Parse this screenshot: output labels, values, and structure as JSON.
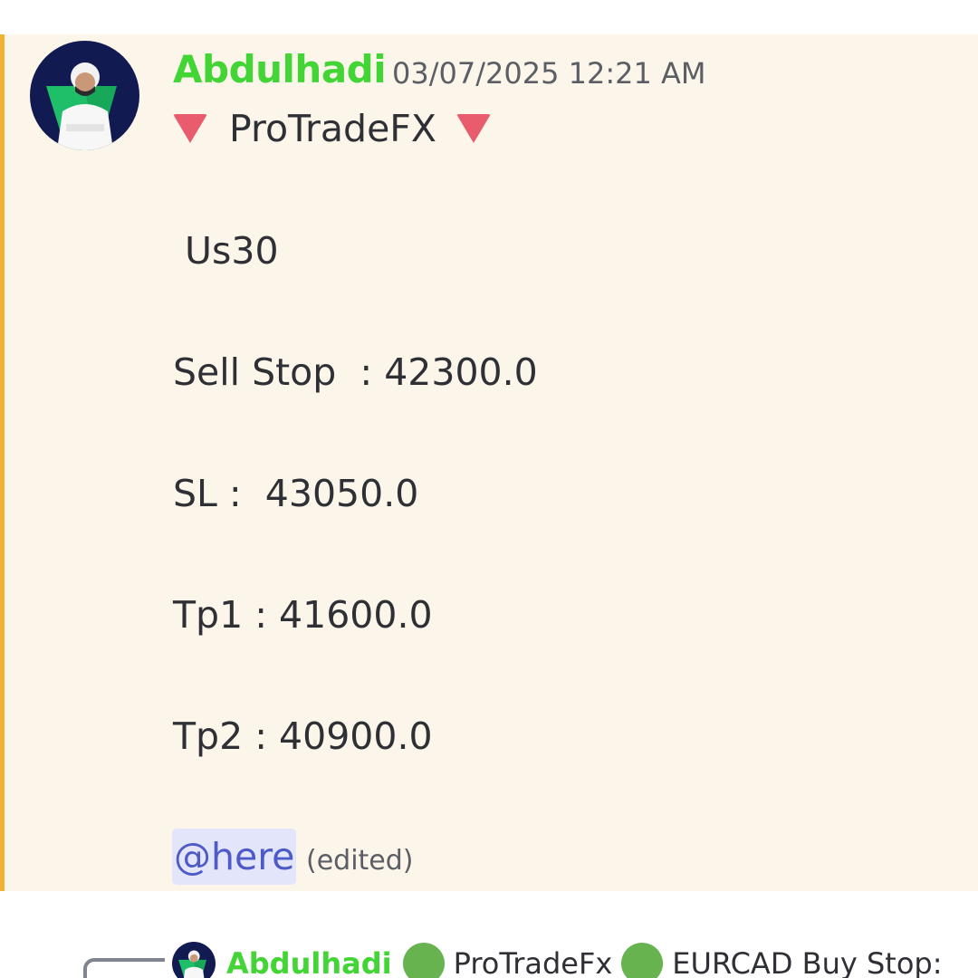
{
  "message": {
    "author": "Abdulhadi",
    "timestamp": "03/07/2025 12:21 AM",
    "title": "ProTradeFX",
    "title_emoji": "red-triangle-down-icon",
    "lines": [
      " Us30",
      "Sell Stop  : 42300.0",
      "SL :  43050.0",
      "Tp1 : 41600.0",
      "Tp2 : 40900.0"
    ],
    "mention": "@here",
    "edited_label": "(edited)"
  },
  "reply_preview": {
    "author": "Abdulhadi",
    "channel_text": "ProTradeFx",
    "snippet": "EURCAD  Buy Stop:"
  },
  "colors": {
    "highlight_bg": "#fcf6ea",
    "highlight_bar": "#f0b232",
    "author": "#43d436",
    "mention_bg": "#e3e5fb",
    "mention_text": "#4e5ac8",
    "triangle": "#e95c6e",
    "green_dot": "#67b34f"
  }
}
